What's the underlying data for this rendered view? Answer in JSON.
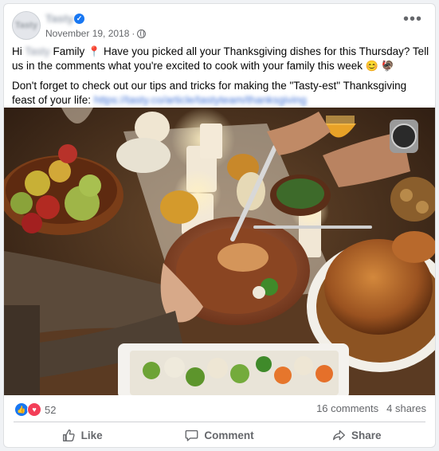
{
  "post": {
    "page_name": "Tasty",
    "avatar_label": "Tasty",
    "date": "November 19, 2018",
    "separator": "·",
    "more_label": "•••",
    "text": {
      "p1_a": "Hi ",
      "p1_name": "Tasty",
      "p1_b": " Family ",
      "p1_c": " Have you picked all your Thanksgiving dishes for this Thursday? Tell us in the comments what you're excited to cook with your family this week ",
      "p2_a": "Don't forget to check out our tips and tricks for making the \"Tasty-est\" Thanksgiving feast of your life: ",
      "p2_link": "https://tasty.co/article/tastyteam/thanksgiving"
    },
    "emojis": {
      "pin": "📍",
      "smile": "😊",
      "turkey": "🦃"
    }
  },
  "engagement": {
    "reaction_count": "52",
    "comments": "16 comments",
    "shares": "4 shares",
    "reaction_icons": [
      "like-reaction",
      "love-reaction"
    ]
  },
  "actions": {
    "like": "Like",
    "comment": "Comment",
    "share": "Share"
  },
  "colors": {
    "accent": "#1877f2",
    "love": "#f33e58",
    "muted": "#65676b"
  }
}
